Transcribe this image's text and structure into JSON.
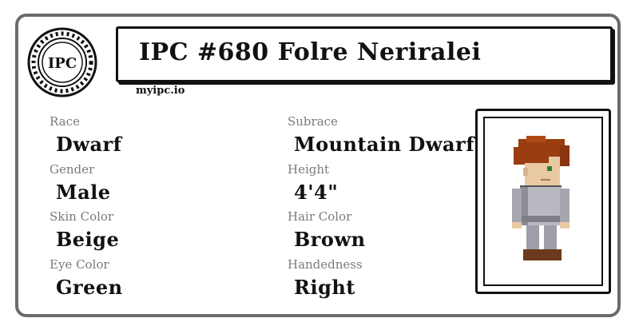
{
  "seal": {
    "text": "IPC"
  },
  "header": {
    "title": "IPC #680 Folre Neriralei",
    "site": "myipc.io"
  },
  "fields": [
    {
      "label": "Race",
      "value": "Dwarf"
    },
    {
      "label": "Subrace",
      "value": "Mountain Dwarf"
    },
    {
      "label": "Gender",
      "value": "Male"
    },
    {
      "label": "Height",
      "value": "4'4\""
    },
    {
      "label": "Skin Color",
      "value": "Beige"
    },
    {
      "label": "Hair Color",
      "value": "Brown"
    },
    {
      "label": "Eye Color",
      "value": "Green"
    },
    {
      "label": "Handedness",
      "value": "Right"
    }
  ],
  "colors": {
    "hair": "#9a3d10",
    "skin": "#e9c9a4",
    "eye": "#2e7d2e",
    "armor": "#b9b9c2",
    "boots": "#6b3a1c"
  },
  "portrait": {
    "icon": "dwarf-character-sprite"
  }
}
